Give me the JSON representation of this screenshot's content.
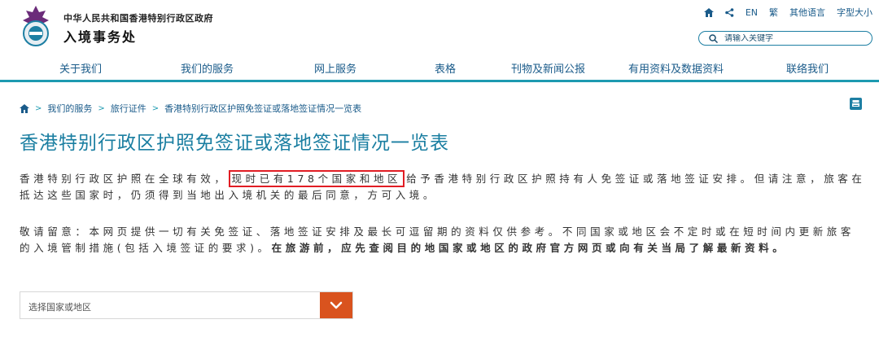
{
  "header": {
    "gov_name": "中华人民共和国香港特别行政区政府",
    "dept_name": "入境事务处"
  },
  "utility": {
    "home_icon": "home-icon",
    "share_icon": "share-icon",
    "en": "EN",
    "traditional": "繁",
    "other_languages": "其他语言",
    "font_size": "字型大小"
  },
  "search": {
    "placeholder": "请输入关键字",
    "icon": "search-icon"
  },
  "nav": {
    "items": [
      {
        "label": "关于我们"
      },
      {
        "label": "我们的服务"
      },
      {
        "label": "网上服务"
      },
      {
        "label": "表格"
      },
      {
        "label": "刊物及新闻公报"
      },
      {
        "label": "有用资料及数据资料"
      },
      {
        "label": "联络我们"
      }
    ]
  },
  "breadcrumb": {
    "items": [
      "我们的服务",
      "旅行证件",
      "香港特别行政区护照免签证或落地签证情况一览表"
    ]
  },
  "page_title": "香港特别行政区护照免签证或落地签证情况一览表",
  "intro": {
    "part1": "香港特别行政区护照在全球有效，",
    "highlight": "现时已有178个国家和地区",
    "part2": "给予香港特别行政区护照持有人免签证或落地签证安排。但请注意，旅客在抵达这些国家时，仍须得到当地出入境机关的最后同意，方可入境。"
  },
  "notice": {
    "normal": "敬请留意：本网页提供一切有关免签证、落地签证安排及最长可逗留期的资料仅供参考。不同国家或地区会不定时或在短时间内更新旅客的入境管制措施(包括入境签证的要求)。",
    "bold": "在旅游前，应先查阅目的地国家或地区的政府官方网页或向有关当局了解最新资料。"
  },
  "country_select": {
    "label": "选择国家或地区"
  },
  "colors": {
    "accent": "#1d9ab0",
    "link": "#1a5b8a",
    "title": "#1a7ea1",
    "highlight_border": "#e11d24",
    "select_button": "#d9531e"
  }
}
